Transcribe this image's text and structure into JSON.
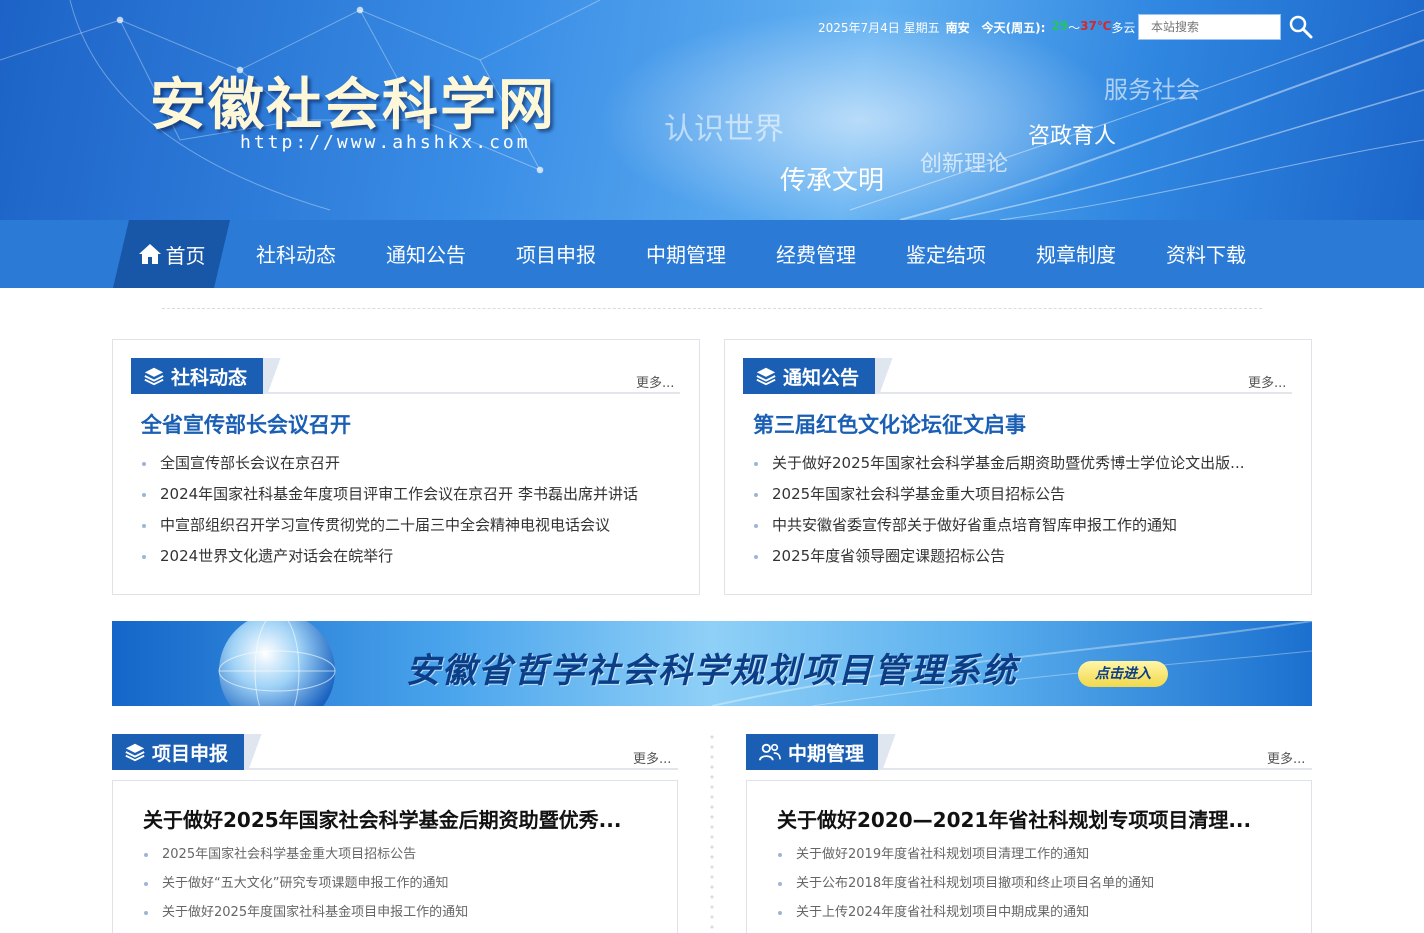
{
  "header": {
    "site_title": "安徽社会科学网",
    "site_url": "http://www.ahshkx.com",
    "slogans": [
      "认识世界",
      "传承文明",
      "创新理论",
      "咨政育人",
      "服务社会"
    ],
    "date": "2025年7月4日 星期五",
    "city": "南安",
    "today_label": "今天(周五):",
    "temp_low": "29",
    "temp_sep": "～",
    "temp_high": "37℃",
    "weather": "多云",
    "search_placeholder": "本站搜索"
  },
  "nav": {
    "home": "首页",
    "items": [
      "社科动态",
      "通知公告",
      "项目申报",
      "中期管理",
      "经费管理",
      "鉴定结项",
      "规章制度",
      "资料下载"
    ]
  },
  "sections": {
    "news": {
      "title": "社科动态",
      "more": "更多...",
      "headline": "全省宣传部长会议召开",
      "items": [
        "全国宣传部长会议在京召开",
        "2024年国家社科基金年度项目评审工作会议在京召开 李书磊出席并讲话",
        "中宣部组织召开学习宣传贯彻党的二十届三中全会精神电视电话会议",
        "2024世界文化遗产对话会在皖举行"
      ]
    },
    "notice": {
      "title": "通知公告",
      "more": "更多...",
      "headline": "第三届红色文化论坛征文启事",
      "items": [
        "关于做好2025年国家社会科学基金后期资助暨优秀博士学位论文出版...",
        "2025年国家社会科学基金重大项目招标公告",
        "中共安徽省委宣传部关于做好省重点培育智库申报工作的通知",
        "2025年度省领导圈定课题招标公告"
      ]
    },
    "apply": {
      "title": "项目申报",
      "more": "更多...",
      "headline": "关于做好2025年国家社会科学基金后期资助暨优秀...",
      "items": [
        "2025年国家社会科学基金重大项目招标公告",
        "关于做好“五大文化”研究专项课题申报工作的通知",
        "关于做好2025年度国家社科基金项目申报工作的通知"
      ]
    },
    "midterm": {
      "title": "中期管理",
      "more": "更多...",
      "headline": "关于做好2020—2021年省社科规划专项项目清理...",
      "items": [
        "关于做好2019年度省社科规划项目清理工作的通知",
        "关于公布2018年度省社科规划项目撤项和终止项目名单的通知",
        "关于上传2024年度省社科规划项目中期成果的通知"
      ]
    }
  },
  "banner": {
    "title": "安徽省哲学社会科学规划项目管理系统",
    "button": "点击进入"
  },
  "icons": {
    "layers": "layers-icon",
    "users": "users-icon",
    "home": "home-icon",
    "search": "search-icon"
  },
  "colors": {
    "nav_bg": "#2a7ad6",
    "nav_active": "#1856a8",
    "tab_bg": "#1a5fb4",
    "headline": "#1a5fb4"
  }
}
